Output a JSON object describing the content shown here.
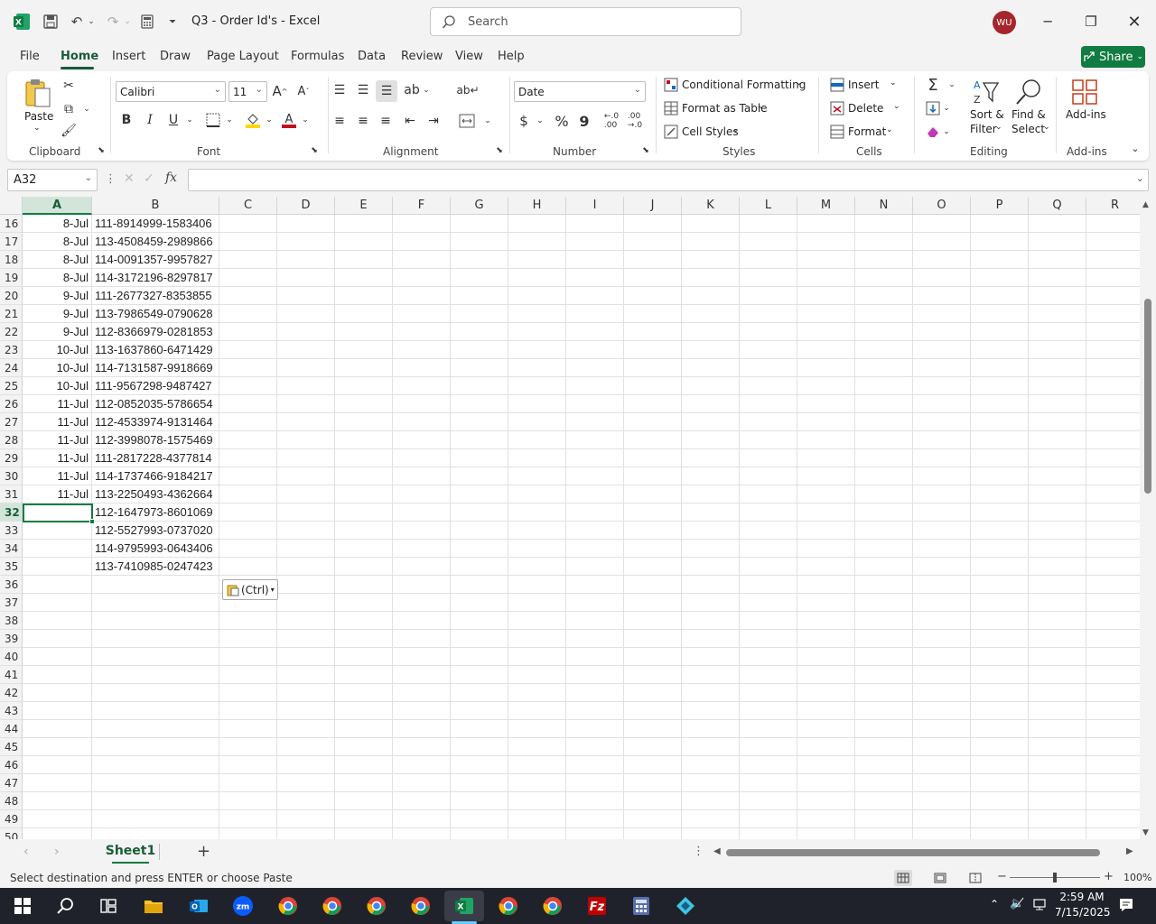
{
  "window": {
    "title": "Q3 - Order Id's  -  Excel",
    "search_placeholder": "Search",
    "avatar_initials": "WU"
  },
  "tabs": [
    "File",
    "Home",
    "Insert",
    "Draw",
    "Page Layout",
    "Formulas",
    "Data",
    "Review",
    "View",
    "Help"
  ],
  "active_tab": "Home",
  "share_label": "Share",
  "ribbon": {
    "clipboard": {
      "paste": "Paste",
      "label": "Clipboard"
    },
    "font": {
      "name": "Calibri",
      "size": "11",
      "label": "Font"
    },
    "alignment": {
      "label": "Alignment"
    },
    "number": {
      "format": "Date",
      "label": "Number"
    },
    "styles": {
      "conditional": "Conditional Formatting",
      "format_table": "Format as Table",
      "cell_styles": "Cell Styles",
      "label": "Styles"
    },
    "cells": {
      "insert": "Insert",
      "delete": "Delete",
      "format": "Format",
      "label": "Cells"
    },
    "editing": {
      "sort_1": "Sort &",
      "sort_2": "Filter",
      "find_1": "Find &",
      "find_2": "Select",
      "label": "Editing"
    },
    "addins": {
      "button": "Add-ins",
      "label": "Add-ins"
    }
  },
  "name_box": "A32",
  "columns": [
    "A",
    "B",
    "C",
    "D",
    "E",
    "F",
    "G",
    "H",
    "I",
    "J",
    "K",
    "L",
    "M",
    "N",
    "O",
    "P",
    "Q",
    "R"
  ],
  "rows": [
    {
      "n": "16",
      "a": "8-Jul",
      "b": "111-8914999-1583406"
    },
    {
      "n": "17",
      "a": "8-Jul",
      "b": "113-4508459-2989866"
    },
    {
      "n": "18",
      "a": "8-Jul",
      "b": "114-0091357-9957827"
    },
    {
      "n": "19",
      "a": "8-Jul",
      "b": "114-3172196-8297817"
    },
    {
      "n": "20",
      "a": "9-Jul",
      "b": "111-2677327-8353855"
    },
    {
      "n": "21",
      "a": "9-Jul",
      "b": "113-7986549-0790628"
    },
    {
      "n": "22",
      "a": "9-Jul",
      "b": "112-8366979-0281853"
    },
    {
      "n": "23",
      "a": "10-Jul",
      "b": "113-1637860-6471429"
    },
    {
      "n": "24",
      "a": "10-Jul",
      "b": "114-7131587-9918669"
    },
    {
      "n": "25",
      "a": "10-Jul",
      "b": "111-9567298-9487427"
    },
    {
      "n": "26",
      "a": "11-Jul",
      "b": "112-0852035-5786654"
    },
    {
      "n": "27",
      "a": "11-Jul",
      "b": "112-4533974-9131464"
    },
    {
      "n": "28",
      "a": "11-Jul",
      "b": "112-3998078-1575469"
    },
    {
      "n": "29",
      "a": "11-Jul",
      "b": "111-2817228-4377814"
    },
    {
      "n": "30",
      "a": "11-Jul",
      "b": "114-1737466-9184217"
    },
    {
      "n": "31",
      "a": "11-Jul",
      "b": "113-2250493-4362664"
    },
    {
      "n": "32",
      "a": "",
      "b": "112-1647973-8601069"
    },
    {
      "n": "33",
      "a": "",
      "b": "112-5527993-0737020"
    },
    {
      "n": "34",
      "a": "",
      "b": "114-9795993-0643406"
    },
    {
      "n": "35",
      "a": "",
      "b": "113-7410985-0247423"
    },
    {
      "n": "36",
      "a": "",
      "b": ""
    },
    {
      "n": "37",
      "a": "",
      "b": ""
    },
    {
      "n": "38",
      "a": "",
      "b": ""
    },
    {
      "n": "39",
      "a": "",
      "b": ""
    },
    {
      "n": "40",
      "a": "",
      "b": ""
    },
    {
      "n": "41",
      "a": "",
      "b": ""
    },
    {
      "n": "42",
      "a": "",
      "b": ""
    },
    {
      "n": "43",
      "a": "",
      "b": ""
    },
    {
      "n": "44",
      "a": "",
      "b": ""
    },
    {
      "n": "45",
      "a": "",
      "b": ""
    },
    {
      "n": "46",
      "a": "",
      "b": ""
    },
    {
      "n": "47",
      "a": "",
      "b": ""
    },
    {
      "n": "48",
      "a": "",
      "b": ""
    },
    {
      "n": "49",
      "a": "",
      "b": ""
    },
    {
      "n": "50",
      "a": "",
      "b": ""
    }
  ],
  "selected_row": "32",
  "paste_options": "(Ctrl)",
  "sheet_tab": "Sheet1",
  "status_text": "Select destination and press ENTER or choose Paste",
  "zoom": "100%",
  "clock": {
    "time": "2:59 AM",
    "date": "7/15/2025"
  },
  "colors": {
    "accent": "#107c41",
    "dark_green": "#185c37",
    "avatar": "#a4262c"
  }
}
